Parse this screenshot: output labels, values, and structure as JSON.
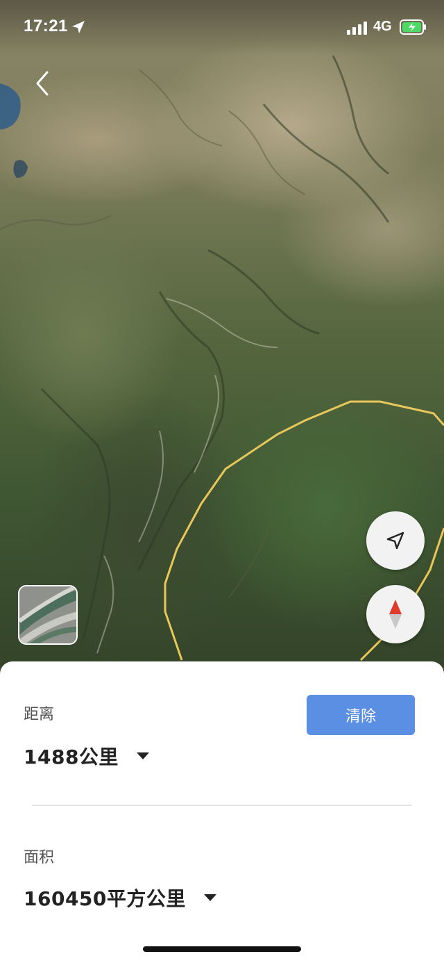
{
  "status_bar": {
    "time": "17:21",
    "network": "4G"
  },
  "map": {
    "boundary_color": "#e9c75a"
  },
  "controls": {
    "layers": "layers-thumbnail-icon",
    "locate": "navigation-arrow-icon",
    "compass": "compass-icon"
  },
  "panel": {
    "distance_label": "距离",
    "distance_value": "1488公里",
    "clear_label": "清除",
    "area_label": "面积",
    "area_value": "160450平方公里"
  },
  "colors": {
    "accent": "#5b8fe3",
    "compass_red": "#e03c2c"
  }
}
